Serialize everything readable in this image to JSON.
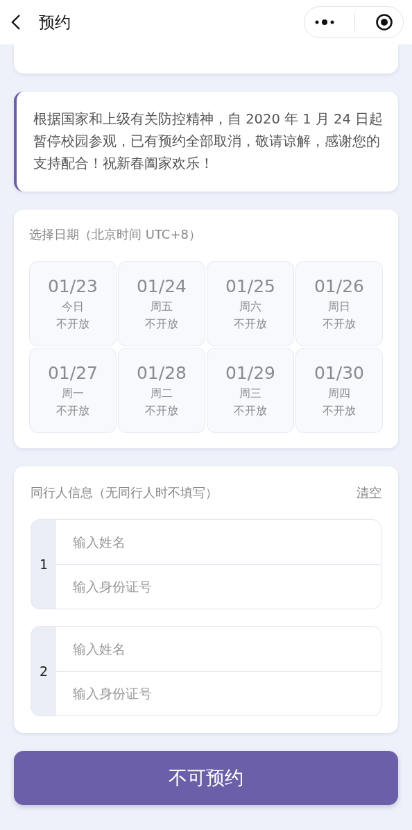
{
  "header": {
    "title": "预约"
  },
  "notice": {
    "text": "根据国家和上级有关防控精神，自 2020 年 1 月 24 日起暂停校园参观，已有预约全部取消，敬请谅解，感谢您的支持配合！祝新春阖家欢乐！"
  },
  "date_picker": {
    "title": "选择日期（北京时间 UTC+8）",
    "dates": [
      {
        "date": "01/23",
        "weekday": "今日",
        "status": "不开放",
        "disabled": true
      },
      {
        "date": "01/24",
        "weekday": "周五",
        "status": "不开放",
        "disabled": true
      },
      {
        "date": "01/25",
        "weekday": "周六",
        "status": "不开放",
        "disabled": true
      },
      {
        "date": "01/26",
        "weekday": "周日",
        "status": "不开放",
        "disabled": true
      },
      {
        "date": "01/27",
        "weekday": "周一",
        "status": "不开放",
        "disabled": true
      },
      {
        "date": "01/28",
        "weekday": "周二",
        "status": "不开放",
        "disabled": true
      },
      {
        "date": "01/29",
        "weekday": "周三",
        "status": "不开放",
        "disabled": true
      },
      {
        "date": "01/30",
        "weekday": "周四",
        "status": "不开放",
        "disabled": true
      }
    ]
  },
  "companions": {
    "title": "同行人信息（无同行人时不填写）",
    "clear_link": "清空",
    "entries": [
      {
        "number": "1",
        "name_placeholder": "输入姓名",
        "id_placeholder": "输入身份证号"
      },
      {
        "number": "2",
        "name_placeholder": "输入姓名",
        "id_placeholder": "输入身份证号"
      }
    ]
  },
  "submit_button": {
    "label": "不可预约"
  }
}
